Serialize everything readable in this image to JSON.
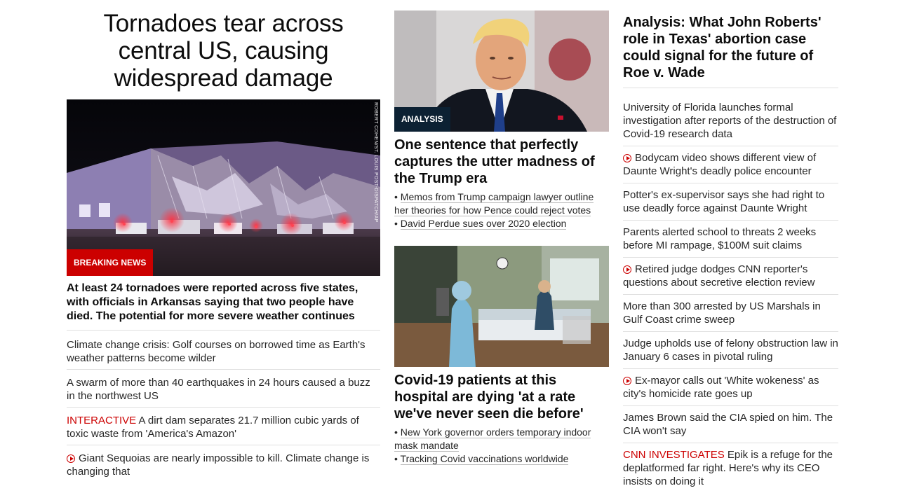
{
  "col1": {
    "headline": "Tornadoes tear across central US, causing widespread damage",
    "photo_credit": "ROBERT COHEN/ST. LOUIS POST-DISPATCH/AP",
    "badge": "BREAKING NEWS",
    "lead": "At least 24 tornadoes were reported across five states, with officials in Arkansas saying that two people have died. The potential for more severe weather continues",
    "items": [
      {
        "tag": "",
        "video": false,
        "text": "Climate change crisis: Golf courses on borrowed time as Earth's weather patterns become wilder"
      },
      {
        "tag": "",
        "video": false,
        "text": "A swarm of more than 40 earthquakes in 24 hours caused a buzz in the northwest US"
      },
      {
        "tag": "INTERACTIVE",
        "video": false,
        "text": "A dirt dam separates 21.7 million cubic yards of toxic waste from 'America's Amazon'"
      },
      {
        "tag": "",
        "video": true,
        "text": "Giant Sequoias are nearly impossible to kill. Climate change is changing that"
      }
    ]
  },
  "col2": {
    "story1": {
      "badge": "ANALYSIS",
      "headline": "One sentence that perfectly captures the utter madness of the Trump era",
      "bullets": [
        "Memos from Trump campaign lawyer outline her theories for how Pence could reject votes",
        "David Perdue sues over 2020 election"
      ]
    },
    "story2": {
      "headline": "Covid-19 patients at this hospital are dying 'at a rate we've never seen die before'",
      "bullets": [
        "New York governor orders temporary indoor mask mandate",
        "Tracking Covid vaccinations worldwide"
      ]
    }
  },
  "col3": {
    "headline": "Analysis: What John Roberts' role in Texas' abortion case could signal for the future of Roe v. Wade",
    "items": [
      {
        "tag": "",
        "video": false,
        "text": "University of Florida launches formal investigation after reports of the destruction of Covid-19 research data"
      },
      {
        "tag": "",
        "video": true,
        "text": "Bodycam video shows different view of Daunte Wright's deadly police encounter"
      },
      {
        "tag": "",
        "video": false,
        "text": "Potter's ex-supervisor says she had right to use deadly force against Daunte Wright"
      },
      {
        "tag": "",
        "video": false,
        "text": "Parents alerted school to threats 2 weeks before MI rampage, $100M suit claims"
      },
      {
        "tag": "",
        "video": true,
        "text": "Retired judge dodges CNN reporter's questions about secretive election review"
      },
      {
        "tag": "",
        "video": false,
        "text": "More than 300 arrested by US Marshals in Gulf Coast crime sweep"
      },
      {
        "tag": "",
        "video": false,
        "text": "Judge upholds use of felony obstruction law in January 6 cases in pivotal ruling"
      },
      {
        "tag": "",
        "video": true,
        "text": "Ex-mayor calls out 'White wokeness' as city's homicide rate goes up"
      },
      {
        "tag": "",
        "video": false,
        "text": "James Brown said the CIA spied on him. The CIA won't say"
      },
      {
        "tag": "CNN INVESTIGATES",
        "video": false,
        "text": "Epik is a refuge for the deplatformed far right. Here's why its CEO insists on doing it"
      }
    ]
  },
  "colors": {
    "accent_red": "#cc0000",
    "analysis_badge": "#0c2133",
    "divider": "#e0e0e0"
  },
  "icons": {
    "video": "play-circle-icon"
  }
}
